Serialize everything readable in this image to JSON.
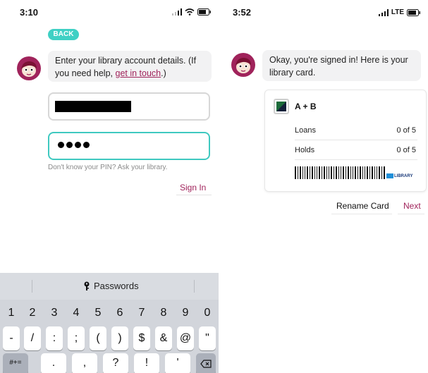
{
  "left_screen": {
    "status": {
      "time": "3:10"
    },
    "back_label": "BACK",
    "bubble": {
      "text_before": "Enter your library account details. (If you need help, ",
      "link": "get in touch",
      "text_after": ".)"
    },
    "pin_hint": "Don't know your PIN? Ask your library.",
    "sign_in_label": "Sign In",
    "keyboard": {
      "passwords_label": "Passwords",
      "row1": [
        "1",
        "2",
        "3",
        "4",
        "5",
        "6",
        "7",
        "8",
        "9",
        "0"
      ],
      "row2": [
        "-",
        "/",
        ":",
        ";",
        "(",
        ")",
        "$",
        "&",
        "@",
        "\""
      ],
      "row3": [
        "#+=",
        ".",
        ",",
        "?",
        "!",
        "'"
      ]
    }
  },
  "right_screen": {
    "status": {
      "time": "3:52",
      "network": "LTE"
    },
    "bubble_text": "Okay, you're signed in! Here is your library card.",
    "card": {
      "name": "A + B",
      "rows": [
        {
          "label": "Loans",
          "value": "0 of 5"
        },
        {
          "label": "Holds",
          "value": "0 of 5"
        }
      ],
      "library_logo_text": "LIBRARY"
    },
    "rename_label": "Rename Card",
    "next_label": "Next"
  },
  "colors": {
    "accent": "#a0235b",
    "teal": "#3fd0c4"
  }
}
